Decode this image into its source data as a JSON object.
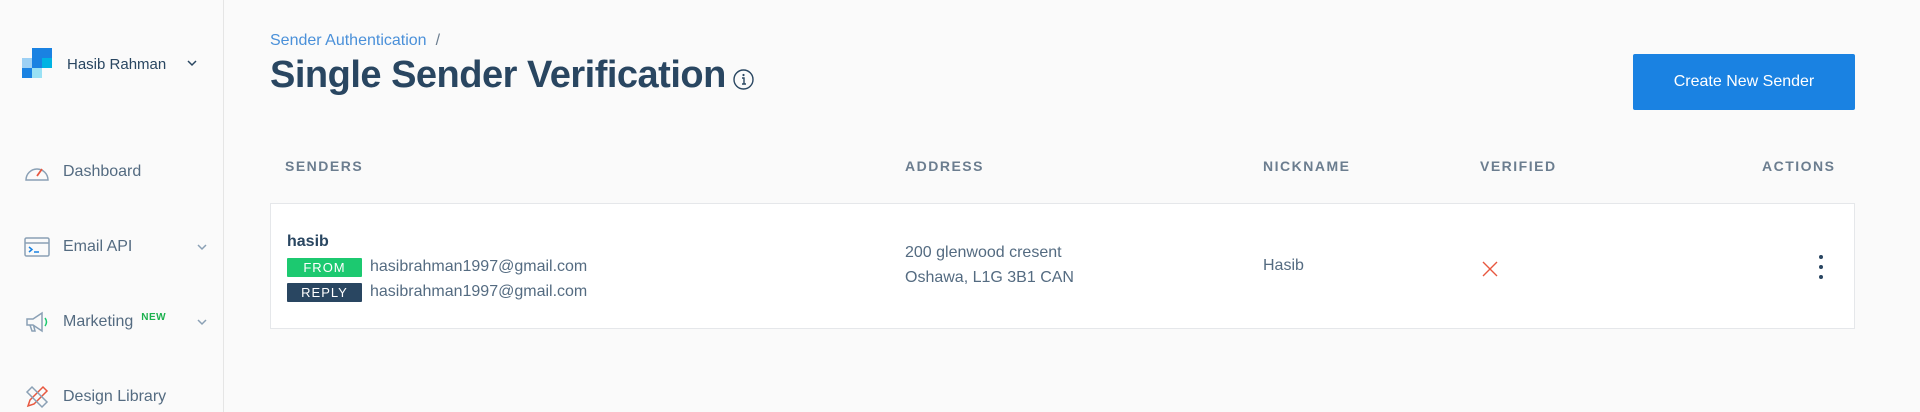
{
  "sidebar": {
    "account_name": "Hasib Rahman",
    "brand_colors": [
      "#1a82e2",
      "#00b3e3",
      "#99e1f4",
      "#9dd0f4"
    ],
    "items": [
      {
        "label": "Dashboard",
        "icon": "gauge-icon"
      },
      {
        "label": "Email API",
        "icon": "terminal-window-icon"
      },
      {
        "label": "Marketing",
        "icon": "megaphone-icon",
        "badge": "NEW"
      },
      {
        "label": "Design Library",
        "icon": "pencil-ruler-icon"
      }
    ]
  },
  "header": {
    "breadcrumb": "Sender Authentication",
    "breadcrumb_sep": "/",
    "title": "Single Sender Verification",
    "create_button": "Create New Sender"
  },
  "table": {
    "columns": [
      "SENDERS",
      "ADDRESS",
      "NICKNAME",
      "VERIFIED",
      "ACTIONS"
    ],
    "rows": [
      {
        "name": "hasib",
        "from_tag": "FROM",
        "from_email": "hasibrahman1997@gmail.com",
        "reply_tag": "REPLY",
        "reply_email": "hasibrahman1997@gmail.com",
        "address_line1": "200 glenwood cresent",
        "address_line2": "Oshawa, L1G 3B1 CAN",
        "nickname": "Hasib",
        "verified": false
      }
    ]
  },
  "colors": {
    "accent": "#1a82e2",
    "from_tag": "#1cc970",
    "reply_tag": "#294661",
    "not_verified": "#e8573f",
    "new_badge": "#1cb14e"
  }
}
